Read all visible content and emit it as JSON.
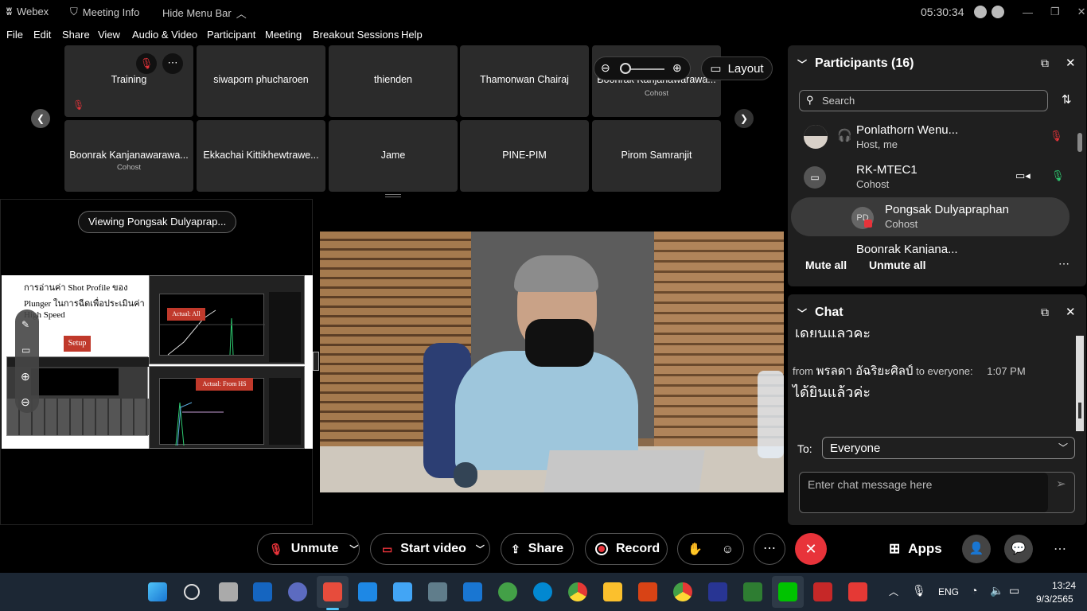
{
  "titlebar": {
    "app_name": "Webex",
    "meeting_info": "Meeting Info",
    "hide_menu": "Hide Menu Bar",
    "clock": "05:30:34"
  },
  "menu": [
    "File",
    "Edit",
    "Share",
    "View",
    "Audio & Video",
    "Participant",
    "Meeting",
    "Breakout Sessions",
    "Help"
  ],
  "tiles_row1": [
    {
      "name": "Training",
      "sub": ""
    },
    {
      "name": "siwaporn phucharoen",
      "sub": ""
    },
    {
      "name": "thienden",
      "sub": ""
    },
    {
      "name": "Thamonwan Chairaj",
      "sub": ""
    },
    {
      "name": "Boonrak Kanjanawarawa...",
      "sub": "Cohost"
    }
  ],
  "tiles_row2": [
    {
      "name": "Boonrak Kanjanawarawa...",
      "sub": "Cohost"
    },
    {
      "name": "Ekkachai Kittikhewtrawe...",
      "sub": ""
    },
    {
      "name": "Jame",
      "sub": ""
    },
    {
      "name": "PINE-PIM",
      "sub": ""
    },
    {
      "name": "Pirom Samranjit",
      "sub": ""
    }
  ],
  "layout_label": "Layout",
  "viewing_label": "Viewing Pongsak Dulyaprap...",
  "slide": {
    "line1": "การอ่านค่า Shot Profile ของ",
    "line2": "Plunger ในการฉีดเพื่อประเมินค่า",
    "line3": "High Speed",
    "setup": "Setup",
    "actual_all": "Actual: All",
    "actual_hs": "Actual: From HS"
  },
  "participants": {
    "title": "Participants (16)",
    "search_placeholder": "Search",
    "list": [
      {
        "name": "Ponlathorn Wenu...",
        "role": "Host, me"
      },
      {
        "name": "RK-MTEC1",
        "role": "Cohost"
      },
      {
        "name": "Pongsak Dulyapraphan",
        "role": "Cohost",
        "initials": "PD"
      },
      {
        "name": "Boonrak Kanjana...",
        "role": ""
      }
    ],
    "mute_all": "Mute all",
    "unmute_all": "Unmute all"
  },
  "chat": {
    "title": "Chat",
    "partial_top": "ได้ยินแล้วค่ะ",
    "msg_from": "from",
    "msg_sender": "พรลดา อัฉริยะศิลป์",
    "msg_to": "to everyone:",
    "msg_time": "1:07 PM",
    "msg_text": "ได้ยินแล้วค่ะ",
    "to_label": "To:",
    "to_value": "Everyone",
    "input_placeholder": "Enter chat message here"
  },
  "toolbar": {
    "unmute": "Unmute",
    "start_video": "Start video",
    "share": "Share",
    "record": "Record",
    "apps": "Apps"
  },
  "taskbar": {
    "lang": "ENG",
    "time": "13:24",
    "date": "9/3/2565"
  },
  "colors": {
    "accent_red": "#e8333a",
    "panel_bg": "#1f1f1f",
    "tile_bg": "#2b2b2b",
    "taskbar_bg": "#1c2734"
  }
}
